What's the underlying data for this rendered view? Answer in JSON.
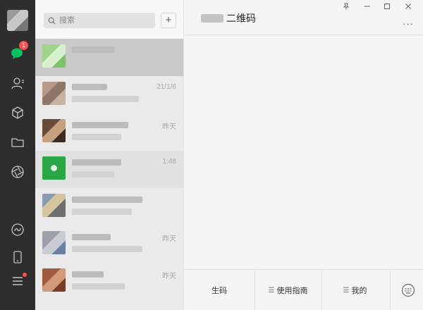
{
  "search": {
    "placeholder": "搜索",
    "add_label": "+"
  },
  "rail": {
    "chat_badge": "1"
  },
  "chats": [
    {
      "time": ""
    },
    {
      "time": "21/1/6"
    },
    {
      "time": "昨天"
    },
    {
      "time": "1:48"
    },
    {
      "time": ""
    },
    {
      "time": "昨天"
    },
    {
      "time": "昨天"
    }
  ],
  "main": {
    "title": "二维码",
    "more_label": "···",
    "menu": [
      {
        "label": "生码"
      },
      {
        "label": "使用指南"
      },
      {
        "label": "我的"
      }
    ]
  },
  "colors": {
    "accent": "#07c160",
    "badge": "#fa5151",
    "rail_bg": "#2e2e2e"
  }
}
